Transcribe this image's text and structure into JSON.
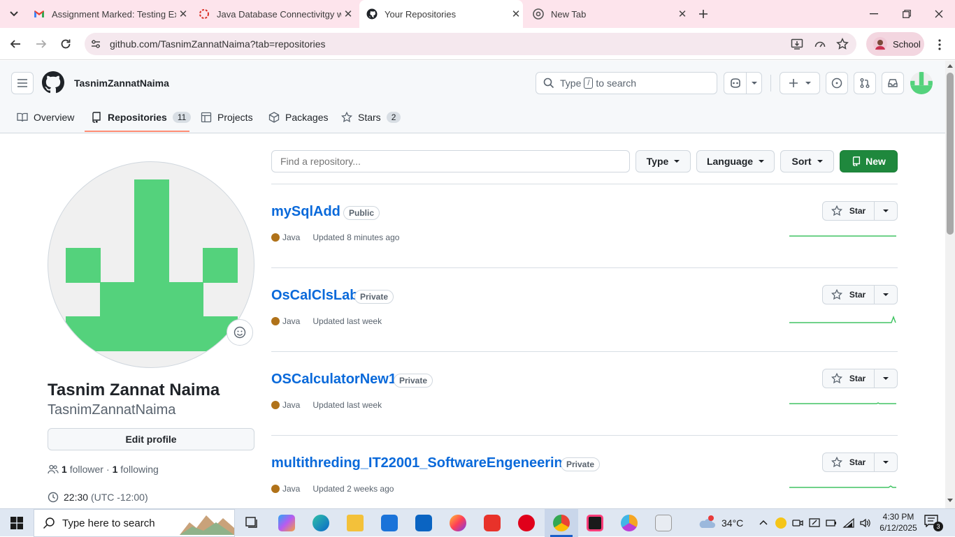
{
  "browser": {
    "tabs": [
      {
        "title": "Assignment Marked: Testing Ex",
        "icon": "gmail-icon"
      },
      {
        "title": "Java Database Connectivitgy w",
        "icon": "loading-icon"
      },
      {
        "title": "Your Repositories",
        "icon": "github-icon"
      },
      {
        "title": "New Tab",
        "icon": "chrome-icon"
      }
    ],
    "url": "github.com/TasnimZannatNaima?tab=repositories",
    "profile_label": "School"
  },
  "gh": {
    "username": "TasnimZannatNaima",
    "search_pre": "Type",
    "search_key": "/",
    "search_post": "to search",
    "nav": [
      {
        "label": "Overview",
        "count": ""
      },
      {
        "label": "Repositories",
        "count": "11"
      },
      {
        "label": "Projects",
        "count": ""
      },
      {
        "label": "Packages",
        "count": ""
      },
      {
        "label": "Stars",
        "count": "2"
      }
    ]
  },
  "profile": {
    "full_name": "Tasnim Zannat Naima",
    "login": "TasnimZannatNaima",
    "edit_label": "Edit profile",
    "followers_count": "1",
    "followers_label": "follower",
    "following_count": "1",
    "following_label": "following",
    "time": "22:30",
    "timezone": "(UTC -12:00)"
  },
  "filters": {
    "find_placeholder": "Find a repository...",
    "type_label": "Type",
    "language_label": "Language",
    "sort_label": "Sort",
    "new_label": "New"
  },
  "repos": [
    {
      "name": "mySqlAdd",
      "visibility": "Public",
      "language": "Java",
      "updated": "Updated 8 minutes ago",
      "star_label": "Star"
    },
    {
      "name": "OsCalClsLab",
      "visibility": "Private",
      "language": "Java",
      "updated": "Updated last week",
      "star_label": "Star"
    },
    {
      "name": "OSCalculatorNew1",
      "visibility": "Private",
      "language": "Java",
      "updated": "Updated last week",
      "star_label": "Star"
    },
    {
      "name": "multithreding_IT22001_SoftwareEngeneering",
      "visibility": "Private",
      "language": "Java",
      "updated": "Updated 2 weeks ago",
      "star_label": "Star"
    }
  ],
  "taskbar": {
    "search_placeholder": "Type here to search",
    "weather": "34°C",
    "time": "4:30 PM",
    "date": "6/12/2025",
    "notif_count": "3"
  },
  "colors": {
    "link": "#0969da",
    "accent_green": "#1f883d",
    "tab_bar": "#fde4ec",
    "java": "#b07219"
  }
}
